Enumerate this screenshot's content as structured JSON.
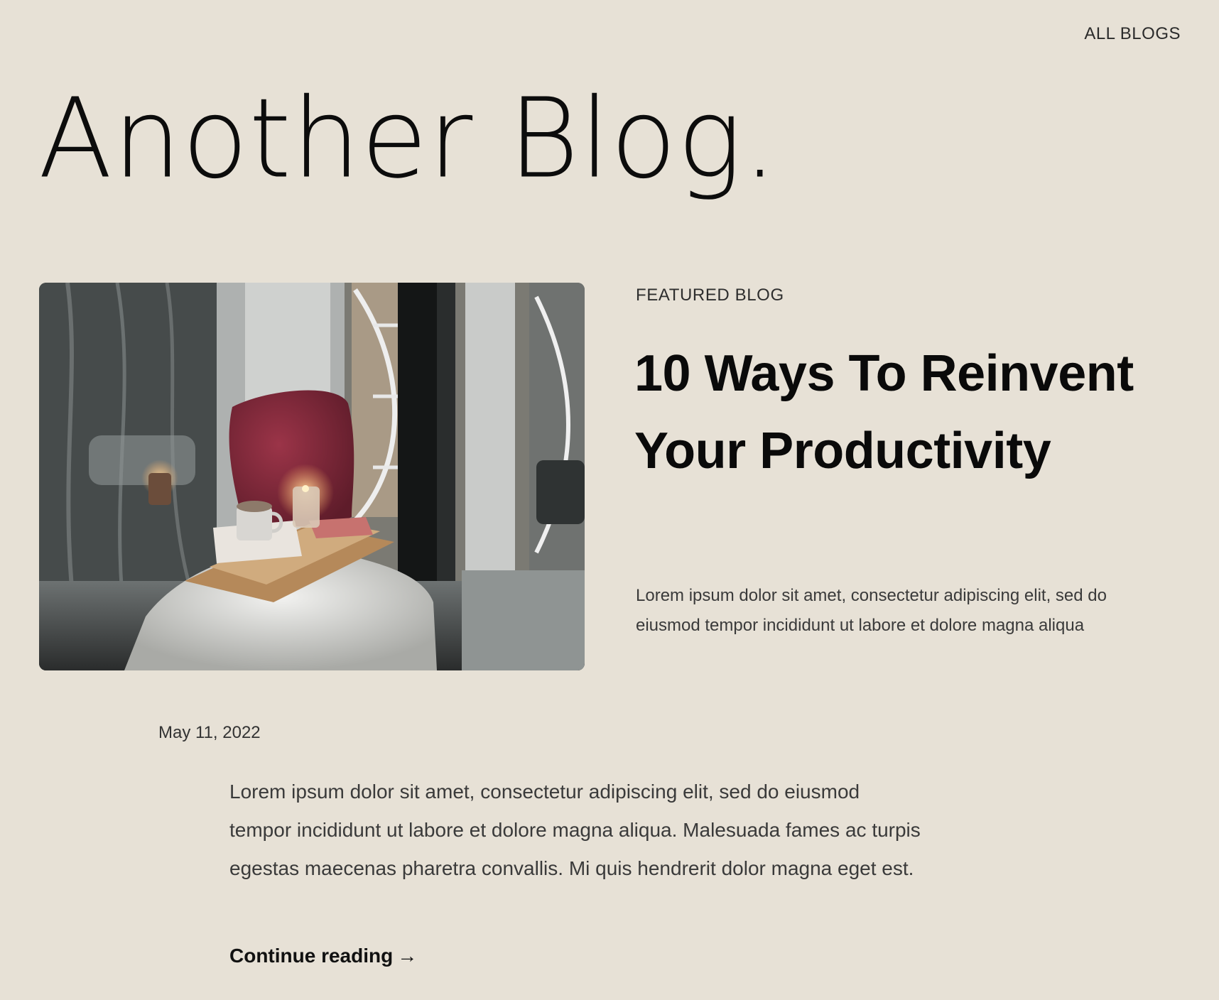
{
  "nav": {
    "all_blogs_label": "ALL BLOGS"
  },
  "site": {
    "title": "Another Blog."
  },
  "featured": {
    "label": "FEATURED BLOG",
    "title": "10 Ways To Reinvent Your Productivity",
    "excerpt": "Lorem ipsum dolor sit amet, consectetur adipiscing elit, sed do eiusmod tempor incididunt ut labore et dolore magna aliqua",
    "image_description_icon": "photo-window-seat-candle"
  },
  "post": {
    "date": "May 11, 2022",
    "body": "Lorem ipsum dolor sit amet, consectetur adipiscing elit, sed do eiusmod tempor incididunt ut labore et dolore magna aliqua. Malesuada fames ac turpis egestas maecenas pharetra convallis. Mi quis hendrerit dolor magna eget est.",
    "continue_label": "Continue reading",
    "continue_arrow": "→"
  },
  "colors": {
    "background": "#e7e1d6",
    "text_primary": "#0a0a0a",
    "text_secondary": "#3a3a3a"
  }
}
